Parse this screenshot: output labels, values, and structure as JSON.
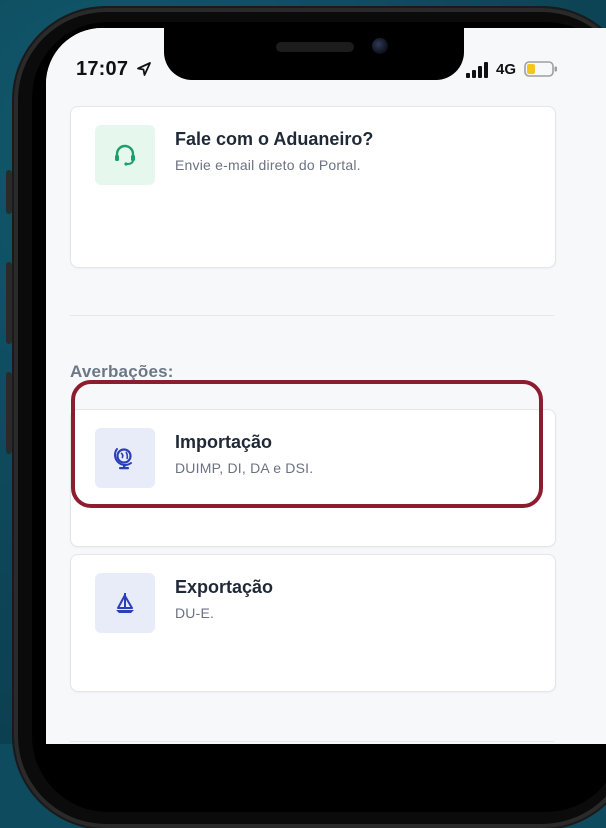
{
  "status_bar": {
    "time": "17:07",
    "network": "4G"
  },
  "cards": [
    {
      "title": "Fale com o Aduaneiro?",
      "subtitle": "Envie e-mail direto do Portal.",
      "icon": "headset-icon",
      "icon_color": "#1e9e6a",
      "icon_bg": "#e6f7ee"
    },
    {
      "title": "Importação",
      "subtitle": "DUIMP, DI, DA e DSI.",
      "icon": "globe-icon",
      "icon_color": "#2b3fb8",
      "icon_bg": "#e8ebf8"
    },
    {
      "title": "Exportação",
      "subtitle": "DU-E.",
      "icon": "sailboat-icon",
      "icon_color": "#2b3fb8",
      "icon_bg": "#e8ebf8"
    }
  ],
  "sections": {
    "averbacoes_label": "Averbações:"
  },
  "colors": {
    "background": "#0f4b5e",
    "highlight": "#8c1d2f",
    "screen_bg": "#f7f8fa"
  }
}
